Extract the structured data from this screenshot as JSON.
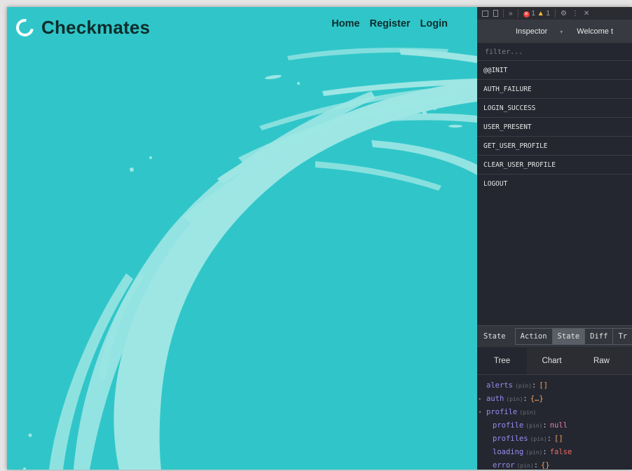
{
  "site": {
    "brand": "Checkmates",
    "nav": [
      "Home",
      "Register",
      "Login"
    ],
    "colors": {
      "background": "#30c6c9",
      "brush": "#9de6e4",
      "text": "#0d2c2c"
    }
  },
  "devtools": {
    "toolbar": {
      "more": "»",
      "errors": "1",
      "warnings": "1",
      "close": "✕",
      "settings": "⚙",
      "menu": "⋮"
    },
    "header": {
      "instance": "Inspector",
      "caret": "▾",
      "welcome": "Welcome t"
    },
    "filter_placeholder": "filter...",
    "actions": [
      "@@INIT",
      "AUTH_FAILURE",
      "LOGIN_SUCCESS",
      "USER_PRESENT",
      "GET_USER_PROFILE",
      "CLEAR_USER_PROFILE",
      "LOGOUT"
    ],
    "monitor_label": "State",
    "monitor_tabs": [
      "Action",
      "State",
      "Diff",
      "Tr"
    ],
    "active_monitor_tab": "State",
    "sub_tabs": [
      "Tree",
      "Chart",
      "Raw"
    ],
    "active_sub_tab": "Tree",
    "tree": [
      {
        "arrow": "",
        "indent": 0,
        "key": "alerts",
        "pin": "(pin)",
        "value": "[]",
        "type": "arr"
      },
      {
        "arrow": "▸",
        "indent": 0,
        "key": "auth",
        "pin": "(pin)",
        "value": "{…}",
        "type": "obj"
      },
      {
        "arrow": "▾",
        "indent": 0,
        "key": "profile",
        "pin": "(pin)",
        "value": "",
        "type": "none"
      },
      {
        "arrow": "",
        "indent": 1,
        "key": "profile",
        "pin": "(pin)",
        "value": "null",
        "type": "null"
      },
      {
        "arrow": "",
        "indent": 1,
        "key": "profiles",
        "pin": "(pin)",
        "value": "[]",
        "type": "arr"
      },
      {
        "arrow": "",
        "indent": 1,
        "key": "loading",
        "pin": "(pin)",
        "value": "false",
        "type": "false"
      },
      {
        "arrow": "",
        "indent": 1,
        "key": "error",
        "pin": "(pin)",
        "value": "{}",
        "type": "obj"
      }
    ]
  }
}
